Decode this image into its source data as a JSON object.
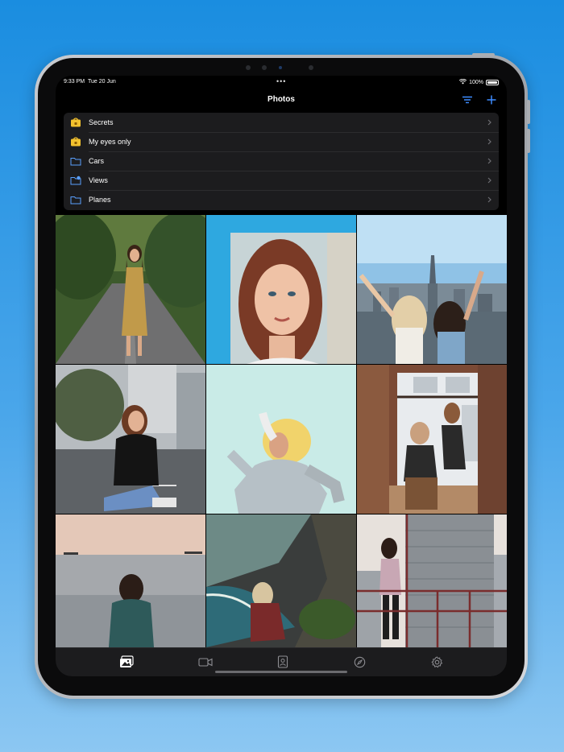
{
  "status_bar": {
    "time": "9:33 PM",
    "date": "Tue 20 Jun",
    "battery": "100%"
  },
  "nav": {
    "title": "Photos",
    "sort_icon": "sort-lines-icon",
    "add_icon": "plus-icon",
    "accent_color": "#3d8cff"
  },
  "folders": [
    {
      "label": "Secrets",
      "icon": "lock-folder-icon"
    },
    {
      "label": "My eyes only",
      "icon": "lock-folder-icon"
    },
    {
      "label": "Cars",
      "icon": "folder-icon"
    },
    {
      "label": "Views",
      "icon": "shared-folder-icon"
    },
    {
      "label": "Planes",
      "icon": "folder-icon"
    }
  ],
  "photos": [
    {
      "subject": "woman on forest road"
    },
    {
      "subject": "woman portrait by blue window"
    },
    {
      "subject": "two women with city skyline"
    },
    {
      "subject": "woman sitting on street"
    },
    {
      "subject": "woman with straw hat"
    },
    {
      "subject": "two women by brick window"
    },
    {
      "subject": "woman facing sea at dusk"
    },
    {
      "subject": "woman on sea cliff"
    },
    {
      "subject": "woman on rooftop with skyscraper"
    }
  ],
  "tabs": [
    {
      "name": "photos-tab",
      "icon": "photos-icon",
      "active": true
    },
    {
      "name": "videos-tab",
      "icon": "video-camera-icon",
      "active": false
    },
    {
      "name": "contacts-tab",
      "icon": "contact-card-icon",
      "active": false
    },
    {
      "name": "browser-tab",
      "icon": "compass-icon",
      "active": false
    },
    {
      "name": "settings-tab",
      "icon": "gear-icon",
      "active": false
    }
  ]
}
